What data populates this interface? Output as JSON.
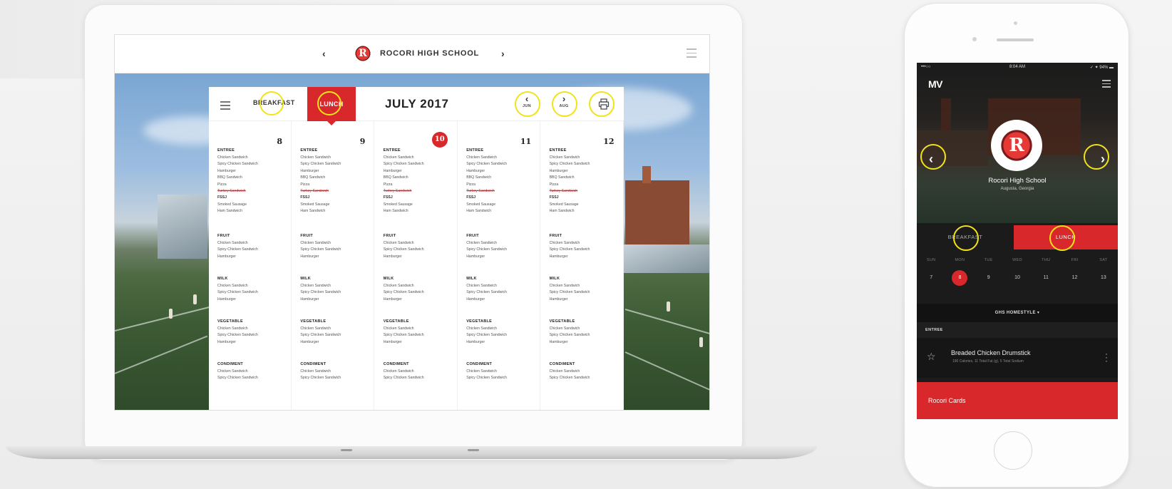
{
  "colors": {
    "accent": "#d9282b",
    "annotation": "#f2e318"
  },
  "web": {
    "topbar": {
      "prev": "‹",
      "next": "›",
      "school": "ROCORI HIGH SCHOOL",
      "logo_letter": "R"
    },
    "menu": {
      "tabs": {
        "breakfast": "BREAKFAST",
        "lunch": "LUNCH"
      },
      "title": "JULY 2017",
      "prev_month": {
        "chevron": "‹",
        "label": "JUN"
      },
      "next_month": {
        "chevron": "›",
        "label": "AUG"
      },
      "icons": {
        "menu": "menu-icon",
        "print": "printer-icon"
      },
      "days": [
        {
          "num": "8",
          "today": false
        },
        {
          "num": "9",
          "today": false
        },
        {
          "num": "10",
          "today": true
        },
        {
          "num": "11",
          "today": false
        },
        {
          "num": "12",
          "today": false
        }
      ],
      "groups": [
        {
          "title": "ENTREE",
          "items": [
            "Chicken Sandwich",
            "Spicy Chicken Sandwich",
            "Hamburger",
            "BBQ Sandwich",
            "Pizza",
            "Turkey Sandwich",
            "FSSJ",
            "Smoked Sausage",
            "Ham Sandwich"
          ]
        },
        {
          "title": "FRUIT",
          "items": [
            "Chicken Sandwich",
            "Spicy Chicken Sandwich",
            "Hamburger"
          ]
        },
        {
          "title": "MILK",
          "items": [
            "Chicken Sandwich",
            "Spicy Chicken Sandwich",
            "Hamburger"
          ]
        },
        {
          "title": "VEGETABLE",
          "items": [
            "Chicken Sandwich",
            "Spicy Chicken Sandwich",
            "Hamburger"
          ]
        },
        {
          "title": "CONDIMENT",
          "items": [
            "Chicken Sandwich",
            "Spicy Chicken Sandwich"
          ]
        }
      ],
      "struck_item": "Turkey Sandwich",
      "bold_item": "FSSJ"
    }
  },
  "mobile": {
    "status": {
      "carrier": "•••○○",
      "time": "8:04 AM",
      "battery": "✓ ✦ 94% ▬"
    },
    "brand": "MV",
    "logo_letter": "R",
    "prev": "‹",
    "next": "›",
    "school_name": "Rocori High School",
    "school_location": "Augusta, Georgia",
    "tabs": {
      "breakfast": "BREAKFAST",
      "lunch": "LUNCH"
    },
    "weekdays": [
      "SUN",
      "MON",
      "TUE",
      "WED",
      "THU",
      "FRI",
      "SAT"
    ],
    "dates": [
      "7",
      "8",
      "9",
      "10",
      "11",
      "12",
      "13"
    ],
    "selected_date": "8",
    "location_selector": "GHS HOMESTYLE ▾",
    "section": "ENTREE",
    "item": {
      "name": "Breaded Chicken Drumstick",
      "info": "190 Calories, 11 Total Fat (g), 5 Total Sodium"
    },
    "cards_label": "Rocori Cards"
  }
}
